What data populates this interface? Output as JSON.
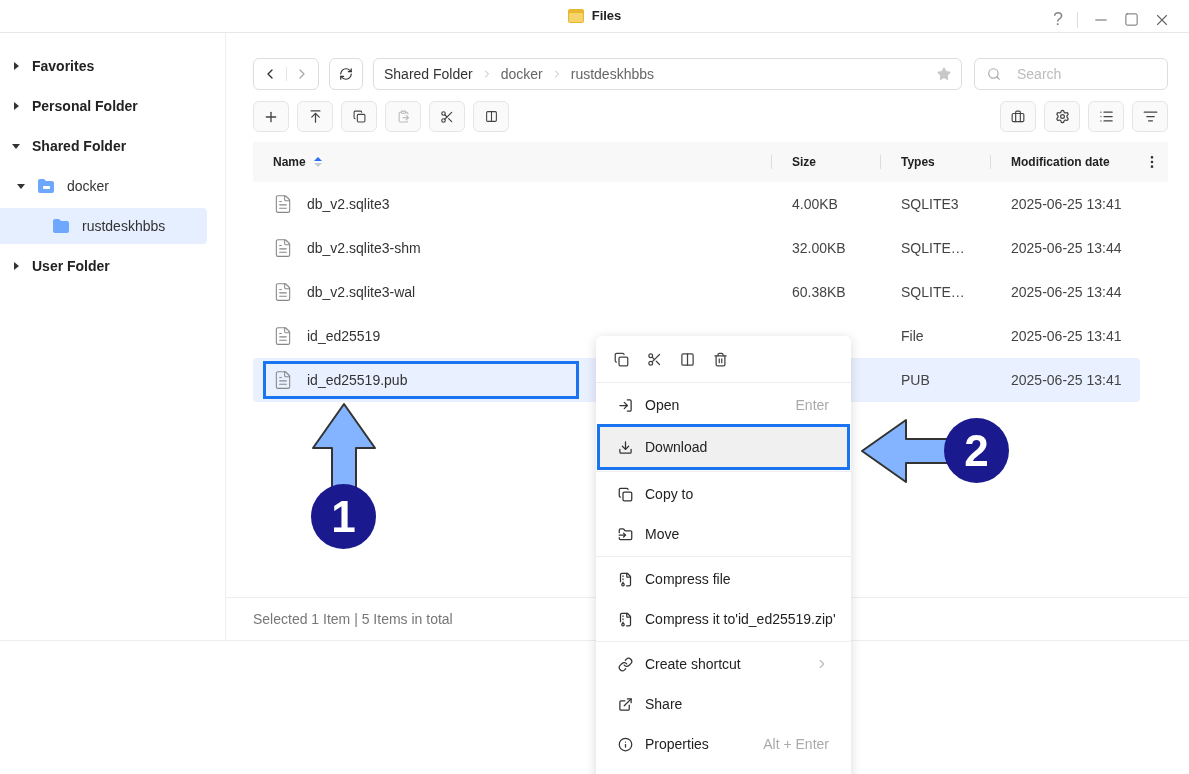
{
  "window": {
    "title": "Files",
    "help": "?"
  },
  "sidebar": {
    "items": [
      {
        "label": "Favorites",
        "expanded": false
      },
      {
        "label": "Personal Folder",
        "expanded": false
      },
      {
        "label": "Shared Folder",
        "expanded": true,
        "children": [
          {
            "label": "docker",
            "expanded": true,
            "selected": false,
            "children": [
              {
                "label": "rustdeskhbbs",
                "selected": true
              }
            ]
          }
        ]
      },
      {
        "label": "User Folder",
        "expanded": false
      }
    ]
  },
  "breadcrumb": [
    "Shared Folder",
    "docker",
    "rustdeskhbbs"
  ],
  "search": {
    "placeholder": "Search"
  },
  "table": {
    "columns": [
      {
        "label": "Name",
        "sorted": true
      },
      {
        "label": "Size",
        "sorted": false
      },
      {
        "label": "Types",
        "sorted": false
      },
      {
        "label": "Modification date",
        "sorted": false
      }
    ],
    "rows": [
      {
        "name": "db_v2.sqlite3",
        "size": "4.00KB",
        "type": "SQLITE3",
        "modified": "2025-06-25 13:41",
        "selected": false
      },
      {
        "name": "db_v2.sqlite3-shm",
        "size": "32.00KB",
        "type": "SQLITE…",
        "modified": "2025-06-25 13:44",
        "selected": false
      },
      {
        "name": "db_v2.sqlite3-wal",
        "size": "60.38KB",
        "type": "SQLITE…",
        "modified": "2025-06-25 13:44",
        "selected": false
      },
      {
        "name": "id_ed25519",
        "type": "File",
        "modified": "2025-06-25 13:41",
        "selected": false
      },
      {
        "name": "id_ed25519.pub",
        "type": "PUB",
        "modified": "2025-06-25 13:41",
        "selected": true
      }
    ]
  },
  "status_bar": "Selected 1 Item | 5 Items in total",
  "context_menu": {
    "groups": [
      [
        {
          "label": "Open",
          "shortcut": "Enter",
          "highlighted": false
        },
        {
          "label": "Download",
          "highlighted": true
        }
      ],
      [
        {
          "label": "Copy to",
          "highlighted": false
        },
        {
          "label": "Move",
          "highlighted": false
        }
      ],
      [
        {
          "label": "Compress file",
          "highlighted": false
        },
        {
          "label": "Compress it to'id_ed25519.zip'",
          "highlighted": false
        }
      ],
      [
        {
          "label": "Create shortcut",
          "highlighted": false,
          "submenu": true
        },
        {
          "label": "Share",
          "highlighted": false
        },
        {
          "label": "Properties",
          "shortcut": "Alt + Enter",
          "highlighted": false
        }
      ]
    ]
  },
  "annotations": [
    {
      "label": "1"
    },
    {
      "label": "2"
    }
  ]
}
